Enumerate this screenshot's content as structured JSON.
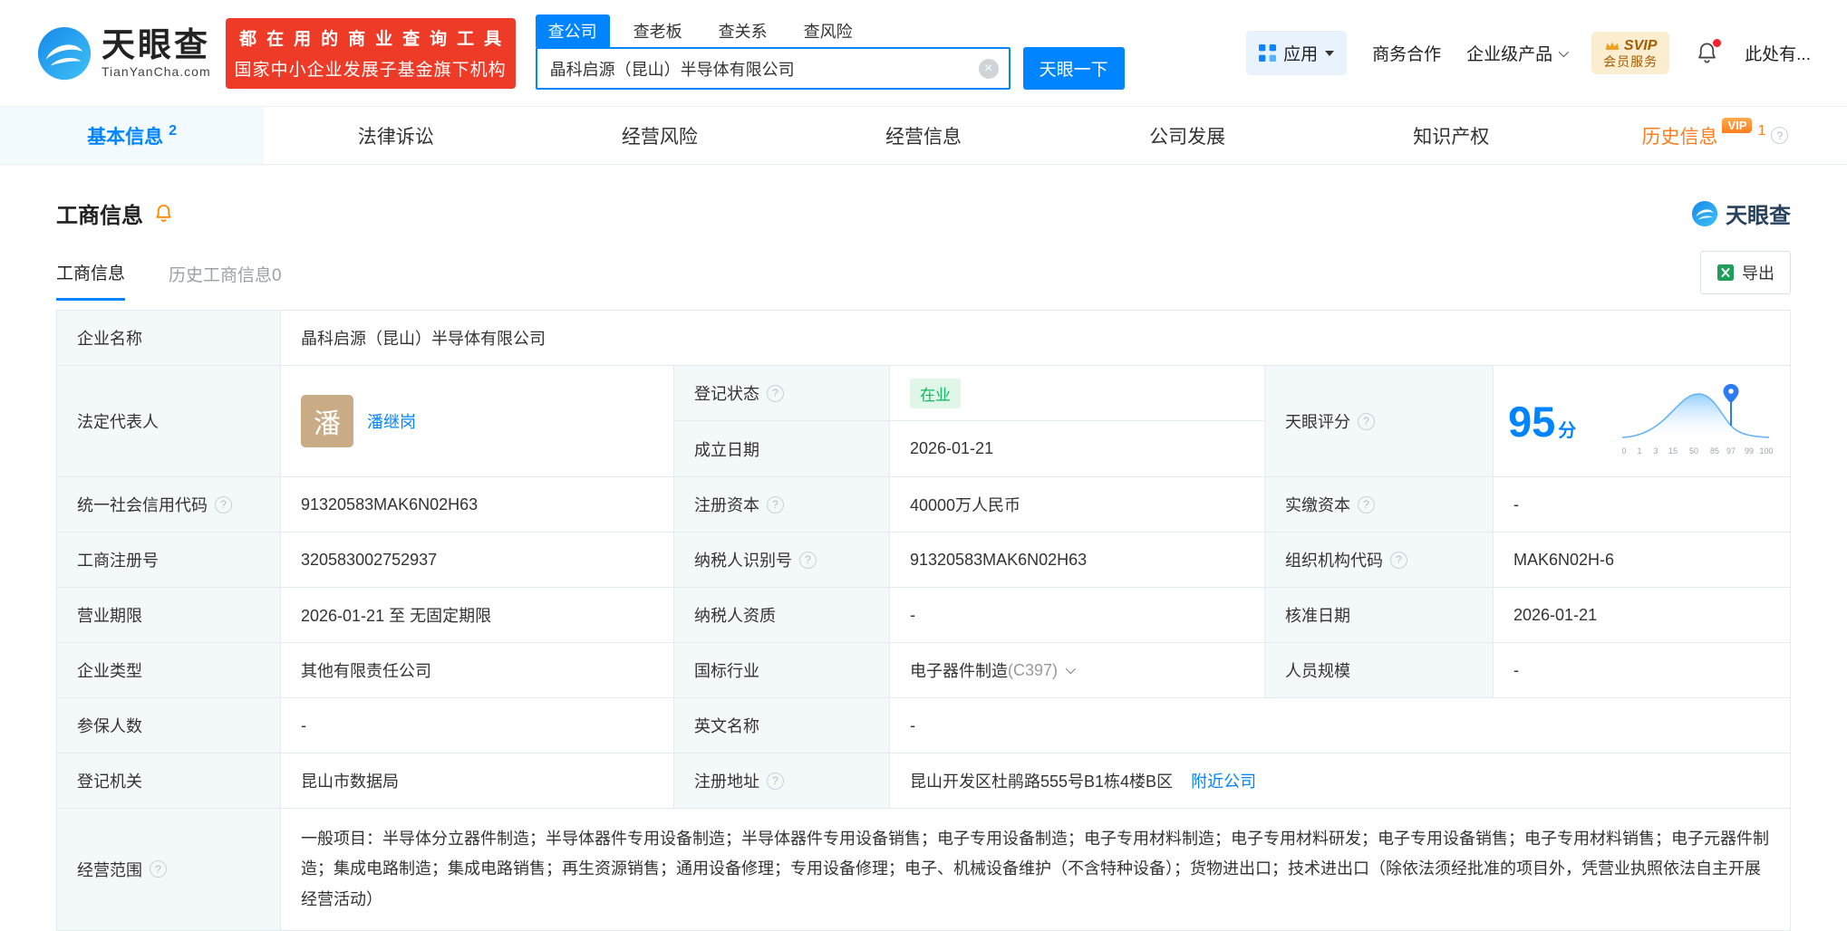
{
  "icons": {
    "clear": "×",
    "help": "?"
  },
  "header": {
    "logo": {
      "brand": "天眼查",
      "domain": "TianYanCha.com"
    },
    "promo": {
      "line1": "都在用的商业查询工具",
      "line2": "国家中小企业发展子基金旗下机构"
    },
    "search": {
      "tabs": [
        {
          "label": "查公司",
          "active": true
        },
        {
          "label": "查老板",
          "active": false
        },
        {
          "label": "查关系",
          "active": false
        },
        {
          "label": "查风险",
          "active": false
        }
      ],
      "value": "晶科启源（昆山）半导体有限公司",
      "button": "天眼一下"
    },
    "menu": {
      "apps": "应用",
      "cooperation": "商务合作",
      "enterprise": "企业级产品",
      "svip_tag": "SVIP",
      "svip_label": "会员服务",
      "account": "此处有..."
    }
  },
  "tabs": [
    {
      "label": "基本信息",
      "badge": "2",
      "active": true
    },
    {
      "label": "法律诉讼"
    },
    {
      "label": "经营风险"
    },
    {
      "label": "经营信息"
    },
    {
      "label": "公司发展"
    },
    {
      "label": "知识产权"
    },
    {
      "label": "历史信息",
      "badge": "1",
      "vip_tag": "VIP"
    }
  ],
  "section": {
    "title": "工商信息",
    "logo": "天眼查",
    "subtabs": [
      {
        "label": "工商信息",
        "active": true
      },
      {
        "label": "历史工商信息0",
        "active": false
      }
    ],
    "export": "导出"
  },
  "fields": {
    "name": {
      "label": "企业名称",
      "value": "晶科启源（昆山）半导体有限公司"
    },
    "legal_rep": {
      "label": "法定代表人",
      "avatar": "潘",
      "value": "潘继岗"
    },
    "status": {
      "label": "登记状态",
      "value": "在业"
    },
    "established": {
      "label": "成立日期",
      "value": "2026-01-21"
    },
    "score": {
      "label": "天眼评分",
      "value": "95",
      "unit": "分",
      "axis": [
        "0",
        "1",
        "3",
        "15",
        "50",
        "85",
        "97",
        "99",
        "100"
      ]
    },
    "credit_code": {
      "label": "统一社会信用代码",
      "value": "91320583MAK6N02H63"
    },
    "reg_capital": {
      "label": "注册资本",
      "value": "40000万人民币"
    },
    "paid_capital": {
      "label": "实缴资本",
      "value": "-"
    },
    "reg_number": {
      "label": "工商注册号",
      "value": "320583002752937"
    },
    "taxpayer_id": {
      "label": "纳税人识别号",
      "value": "91320583MAK6N02H63"
    },
    "org_code": {
      "label": "组织机构代码",
      "value": "MAK6N02H-6"
    },
    "business_term": {
      "label": "营业期限",
      "value": "2026-01-21 至 无固定期限"
    },
    "taxpayer_quality": {
      "label": "纳税人资质",
      "value": "-"
    },
    "approval_date": {
      "label": "核准日期",
      "value": "2026-01-21"
    },
    "company_type": {
      "label": "企业类型",
      "value": "其他有限责任公司"
    },
    "industry": {
      "label": "国标行业",
      "value": "电子器件制造",
      "code": "(C397)"
    },
    "staff_size": {
      "label": "人员规模",
      "value": "-"
    },
    "insured_count": {
      "label": "参保人数",
      "value": "-"
    },
    "english_name": {
      "label": "英文名称",
      "value": "-"
    },
    "reg_authority": {
      "label": "登记机关",
      "value": "昆山市数据局"
    },
    "reg_address": {
      "label": "注册地址",
      "value": "昆山开发区杜鹃路555号B1栋4楼B区",
      "link": "附近公司"
    },
    "business_scope": {
      "label": "经营范围",
      "value": "一般项目：半导体分立器件制造；半导体器件专用设备制造；半导体器件专用设备销售；电子专用设备制造；电子专用材料制造；电子专用材料研发；电子专用设备销售；电子专用材料销售；电子元器件制造；集成电路制造；集成电路销售；再生资源销售；通用设备修理；专用设备修理；电子、机械设备维护（不含特种设备）；货物进出口；技术进出口（除依法须经批准的项目外，凭营业执照依法自主开展经营活动）"
    }
  },
  "colors": {
    "primary": "#0084ff",
    "green": "#12b75f",
    "orange": "#ff7d1e",
    "red_banner": "#ee3b28",
    "label_bg": "#f3f9fb"
  }
}
